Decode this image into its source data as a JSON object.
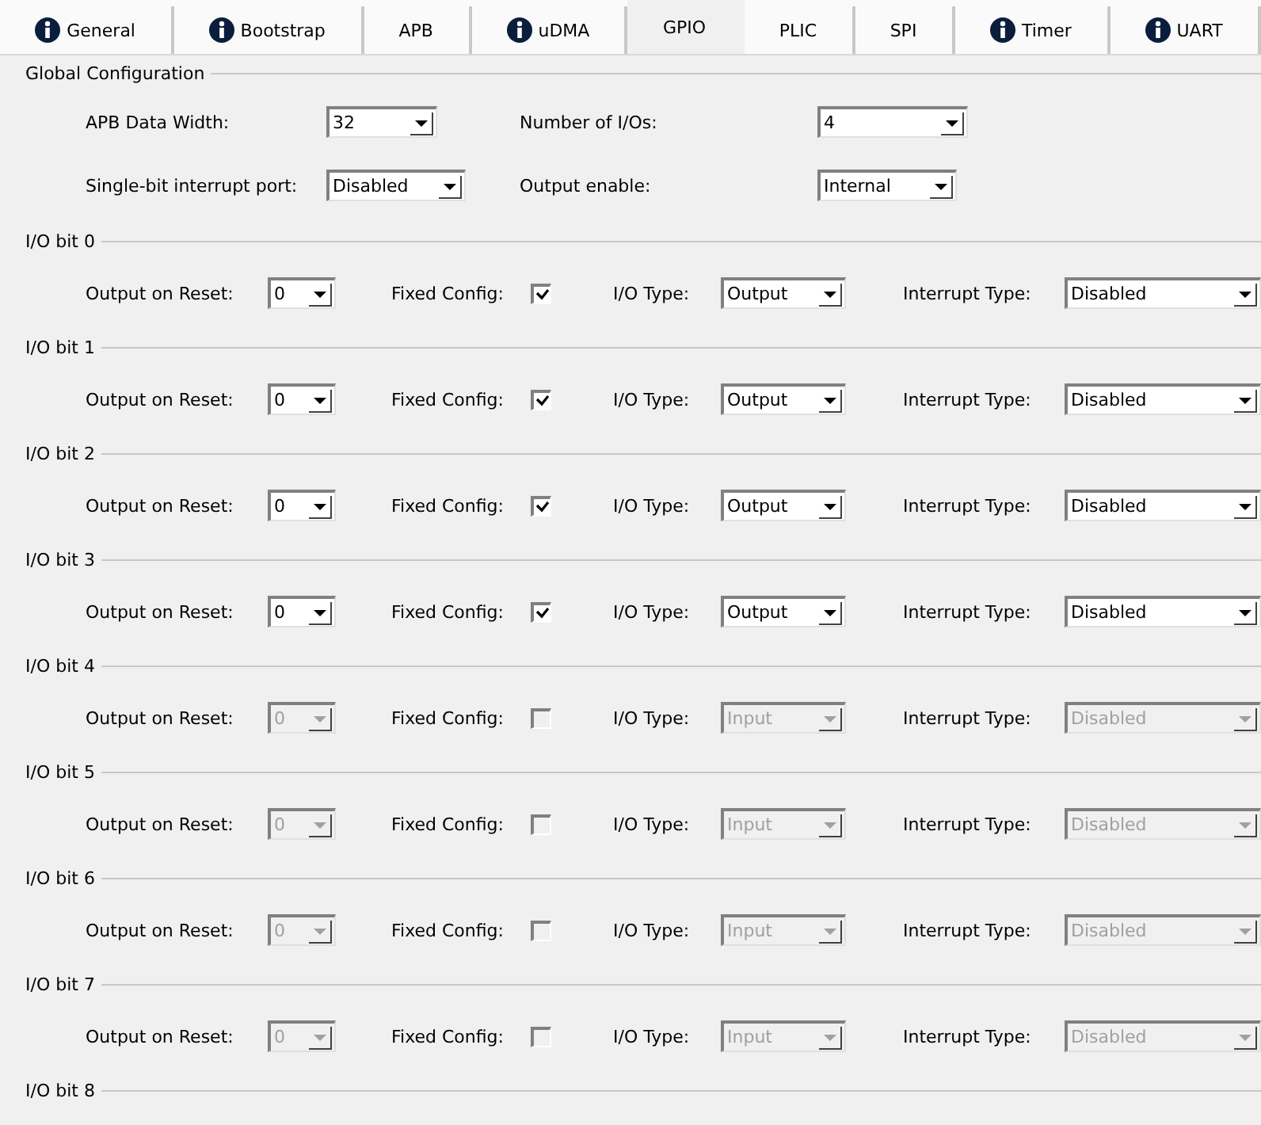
{
  "tabs": [
    {
      "label": "General",
      "info": true,
      "selected": false
    },
    {
      "label": "Bootstrap",
      "info": true,
      "selected": false
    },
    {
      "label": "APB",
      "info": false,
      "selected": false
    },
    {
      "label": "uDMA",
      "info": true,
      "selected": false
    },
    {
      "label": "GPIO",
      "info": false,
      "selected": true
    },
    {
      "label": "PLIC",
      "info": false,
      "selected": false
    },
    {
      "label": "SPI",
      "info": false,
      "selected": false
    },
    {
      "label": "Timer",
      "info": true,
      "selected": false
    },
    {
      "label": "UART",
      "info": true,
      "selected": false
    }
  ],
  "global": {
    "title": "Global Configuration",
    "fields": [
      {
        "label": "APB Data Width:",
        "value": "32"
      },
      {
        "label": "Number of I/Os:",
        "value": "4"
      },
      {
        "label": "Single-bit interrupt port:",
        "value": "Disabled"
      },
      {
        "label": "Output enable:",
        "value": "Internal"
      }
    ]
  },
  "io_bits": [
    {
      "title": "I/O bit 0",
      "disabled": false,
      "output_on_reset": {
        "label": "Output on Reset:",
        "value": "0"
      },
      "fixed_config": {
        "label": "Fixed Config:",
        "checked": true
      },
      "io_type": {
        "label": "I/O Type:",
        "value": "Output"
      },
      "interrupt_type": {
        "label": "Interrupt Type:",
        "value": "Disabled"
      }
    },
    {
      "title": "I/O bit 1",
      "disabled": false,
      "output_on_reset": {
        "label": "Output on Reset:",
        "value": "0"
      },
      "fixed_config": {
        "label": "Fixed Config:",
        "checked": true
      },
      "io_type": {
        "label": "I/O Type:",
        "value": "Output"
      },
      "interrupt_type": {
        "label": "Interrupt Type:",
        "value": "Disabled"
      }
    },
    {
      "title": "I/O bit 2",
      "disabled": false,
      "output_on_reset": {
        "label": "Output on Reset:",
        "value": "0"
      },
      "fixed_config": {
        "label": "Fixed Config:",
        "checked": true
      },
      "io_type": {
        "label": "I/O Type:",
        "value": "Output"
      },
      "interrupt_type": {
        "label": "Interrupt Type:",
        "value": "Disabled"
      }
    },
    {
      "title": "I/O bit 3",
      "disabled": false,
      "output_on_reset": {
        "label": "Output on Reset:",
        "value": "0"
      },
      "fixed_config": {
        "label": "Fixed Config:",
        "checked": true
      },
      "io_type": {
        "label": "I/O Type:",
        "value": "Output"
      },
      "interrupt_type": {
        "label": "Interrupt Type:",
        "value": "Disabled"
      }
    },
    {
      "title": "I/O bit 4",
      "disabled": true,
      "output_on_reset": {
        "label": "Output on Reset:",
        "value": "0"
      },
      "fixed_config": {
        "label": "Fixed Config:",
        "checked": false
      },
      "io_type": {
        "label": "I/O Type:",
        "value": "Input"
      },
      "interrupt_type": {
        "label": "Interrupt Type:",
        "value": "Disabled"
      }
    },
    {
      "title": "I/O bit 5",
      "disabled": true,
      "output_on_reset": {
        "label": "Output on Reset:",
        "value": "0"
      },
      "fixed_config": {
        "label": "Fixed Config:",
        "checked": false
      },
      "io_type": {
        "label": "I/O Type:",
        "value": "Input"
      },
      "interrupt_type": {
        "label": "Interrupt Type:",
        "value": "Disabled"
      }
    },
    {
      "title": "I/O bit 6",
      "disabled": true,
      "output_on_reset": {
        "label": "Output on Reset:",
        "value": "0"
      },
      "fixed_config": {
        "label": "Fixed Config:",
        "checked": false
      },
      "io_type": {
        "label": "I/O Type:",
        "value": "Input"
      },
      "interrupt_type": {
        "label": "Interrupt Type:",
        "value": "Disabled"
      }
    },
    {
      "title": "I/O bit 7",
      "disabled": true,
      "output_on_reset": {
        "label": "Output on Reset:",
        "value": "0"
      },
      "fixed_config": {
        "label": "Fixed Config:",
        "checked": false
      },
      "io_type": {
        "label": "I/O Type:",
        "value": "Input"
      },
      "interrupt_type": {
        "label": "Interrupt Type:",
        "value": "Disabled"
      }
    }
  ],
  "partial_section": {
    "title": "I/O bit 8"
  }
}
